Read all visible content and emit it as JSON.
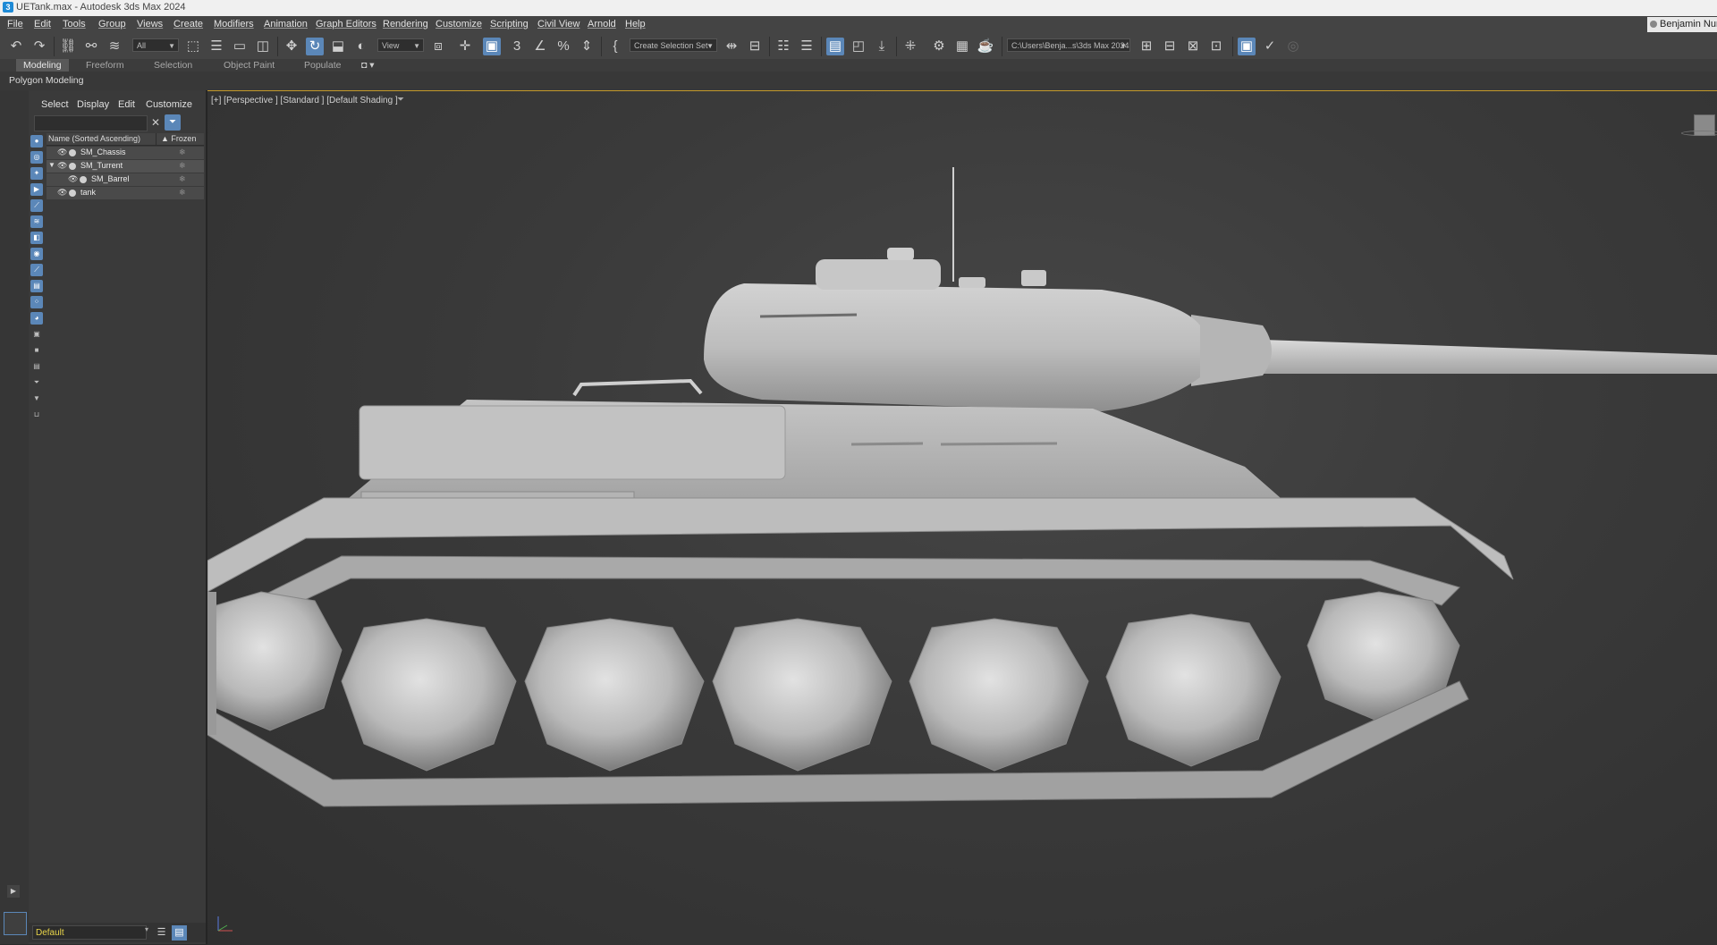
{
  "window": {
    "title": "UETank.max - Autodesk 3ds Max 2024",
    "app_icon_letter": "3"
  },
  "menu": {
    "items": [
      "File",
      "Edit",
      "Tools",
      "Group",
      "Views",
      "Create",
      "Modifiers",
      "Animation",
      "Graph Editors",
      "Rendering",
      "Customize",
      "Scripting",
      "Civil View",
      "Arnold",
      "Help"
    ],
    "user": "Benjamin Nun"
  },
  "toolbar": {
    "selection_filter": "All",
    "coordinate_system": "View",
    "selection_set_placeholder": "Create Selection Set",
    "project_path": "C:\\Users\\Benja...s\\3ds Max 2024",
    "snap_label": "3"
  },
  "ribbon": {
    "tabs": [
      "Modeling",
      "Freeform",
      "Selection",
      "Object Paint",
      "Populate"
    ],
    "active_tab": "Modeling",
    "panel": "Polygon Modeling"
  },
  "scene_explorer": {
    "menu": [
      "Select",
      "Display",
      "Edit",
      "Customize"
    ],
    "columns": {
      "name": "Name (Sorted Ascending)",
      "frozen": "▲ Frozen"
    },
    "rows": [
      {
        "name": "SM_Chassis",
        "level": 0,
        "expanded": false
      },
      {
        "name": "SM_Turrent",
        "level": 0,
        "expanded": true
      },
      {
        "name": "SM_Barrel",
        "level": 1,
        "expanded": false
      },
      {
        "name": "tank",
        "level": 0,
        "expanded": false
      }
    ],
    "layer": "Default"
  },
  "viewport": {
    "label": "[+] [Perspective ] [Standard ] [Default Shading ]"
  },
  "colors": {
    "accent": "#5b87b8",
    "viewport_border": "#c49a2a",
    "layer_text": "#e8d44a"
  }
}
